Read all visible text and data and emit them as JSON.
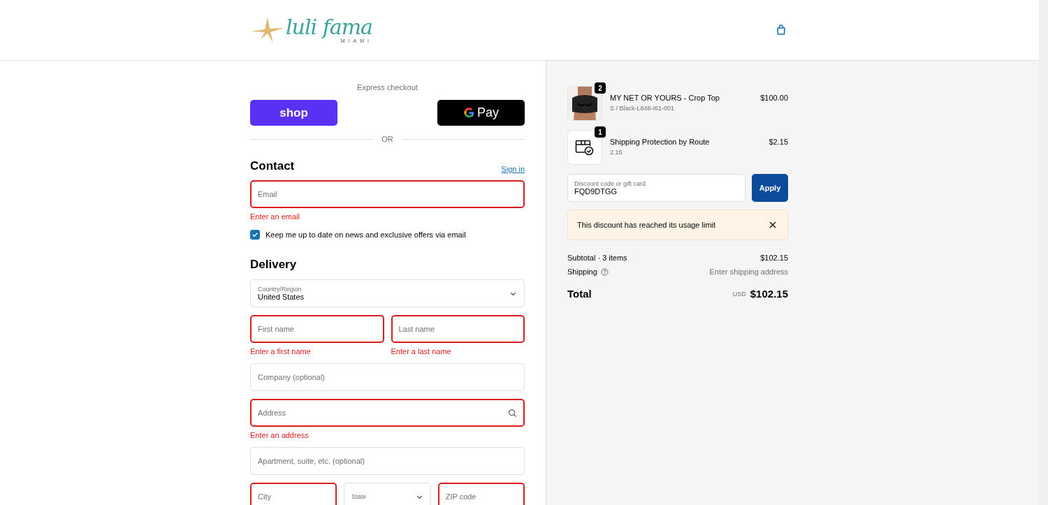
{
  "header": {
    "logo": {
      "script": "luli fama",
      "subtitle": "MIAMI"
    }
  },
  "express": {
    "title": "Express checkout",
    "buttons": [
      {
        "kind": "shop",
        "label": "shop"
      },
      {
        "kind": "gpay",
        "label": "Pay"
      }
    ],
    "divider": "OR"
  },
  "contact": {
    "heading": "Contact",
    "sign_in": "Sign in",
    "email": {
      "placeholder": "Email",
      "invalid": true,
      "error": "Enter an email"
    },
    "newsletter": {
      "label": "Keep me up to date on news and exclusive offers via email",
      "checked": true
    }
  },
  "delivery": {
    "heading": "Delivery",
    "rows": [
      [
        {
          "kind": "select",
          "label": "Country/Region",
          "value": "United States",
          "invalid": false
        }
      ],
      [
        {
          "kind": "text",
          "placeholder": "First name",
          "invalid": true,
          "error": "Enter a first name"
        },
        {
          "kind": "text",
          "placeholder": "Last name",
          "invalid": true,
          "error": "Enter a last name"
        }
      ],
      [
        {
          "kind": "text",
          "placeholder": "Company (optional)",
          "invalid": false
        }
      ],
      [
        {
          "kind": "search",
          "placeholder": "Address",
          "invalid": true,
          "error": "Enter an address"
        }
      ],
      [
        {
          "kind": "text",
          "placeholder": "Apartment, suite, etc. (optional)",
          "invalid": false
        }
      ],
      [
        {
          "kind": "text",
          "placeholder": "City",
          "invalid": true
        },
        {
          "kind": "select",
          "label": "State",
          "invalid": false
        },
        {
          "kind": "text",
          "placeholder": "ZIP code",
          "invalid": true
        }
      ]
    ]
  },
  "summary": {
    "items": [
      {
        "quantity": "2",
        "name": "MY NET OR YOURS - Crop Top",
        "variant": "S / Black-L848-I61-001",
        "price": "$100.00"
      },
      {
        "kind": "icon",
        "quantity": "1",
        "name": "Shipping Protection by Route",
        "variant": "2.15",
        "price": "$2.15"
      }
    ],
    "discount": {
      "label": "Discount code or gift card",
      "value": "FQD9DTGG",
      "button": "Apply"
    },
    "notice": {
      "text": "This discount has reached its usage limit"
    },
    "lines": [
      {
        "label": "Subtotal · 3 items",
        "value": "$102.15",
        "help": false
      },
      {
        "label": "Shipping",
        "value": "Enter shipping address",
        "help": true
      }
    ],
    "total": {
      "label": "Total",
      "currency": "USD",
      "amount": "$102.15"
    }
  }
}
